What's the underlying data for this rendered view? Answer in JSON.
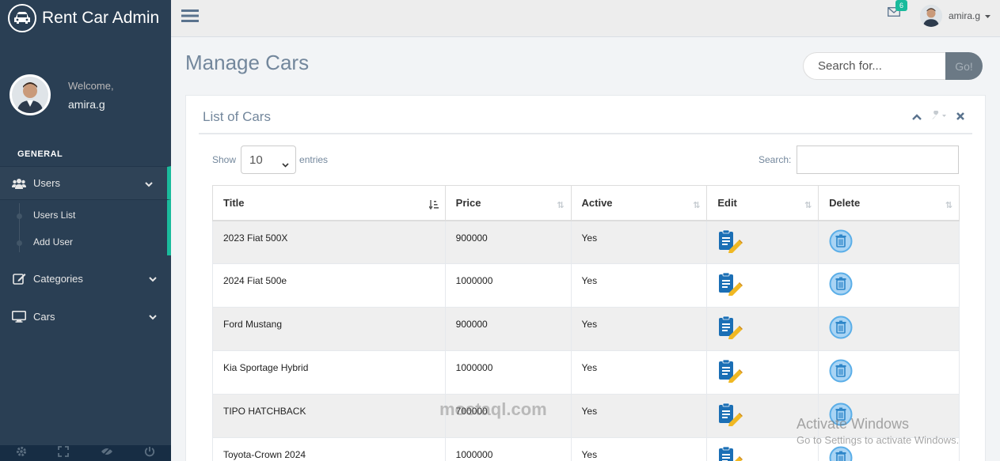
{
  "brand": {
    "title": "Rent Car Admin"
  },
  "profile": {
    "welcome": "Welcome,",
    "username": "amira.g"
  },
  "sidebar": {
    "section": "GENERAL",
    "items": [
      {
        "label": "Users",
        "icon": "users-icon",
        "expanded": true,
        "children": [
          {
            "label": "Users List"
          },
          {
            "label": "Add User"
          }
        ]
      },
      {
        "label": "Categories",
        "icon": "edit-icon"
      },
      {
        "label": "Cars",
        "icon": "monitor-icon"
      }
    ]
  },
  "topnav": {
    "mail_count": "6",
    "username": "amira.g"
  },
  "page": {
    "title": "Manage Cars"
  },
  "search": {
    "placeholder": "Search for...",
    "go": "Go!"
  },
  "panel": {
    "title": "List of Cars"
  },
  "table_controls": {
    "show": "Show",
    "entries_value": "10",
    "entries": "entries",
    "search_label": "Search:"
  },
  "table": {
    "columns": [
      "Title",
      "Price",
      "Active",
      "Edit",
      "Delete"
    ],
    "rows": [
      {
        "title": "2023 Fiat 500X",
        "price": "900000",
        "active": "Yes"
      },
      {
        "title": "2024 Fiat 500e",
        "price": "1000000",
        "active": "Yes"
      },
      {
        "title": "Ford Mustang",
        "price": "900000",
        "active": "Yes"
      },
      {
        "title": "Kia Sportage Hybrid",
        "price": "1000000",
        "active": "Yes"
      },
      {
        "title": "TIPO HATCHBACK",
        "price": "700000",
        "active": "Yes"
      },
      {
        "title": "Toyota-Crown 2024",
        "price": "1000000",
        "active": "Yes"
      }
    ]
  },
  "overlay": {
    "watermark": "mostaql.com",
    "activate_title": "Activate Windows",
    "activate_sub": "Go to Settings to activate Windows."
  },
  "colors": {
    "sidebar": "#2a3f54",
    "accent": "#1abb9c",
    "edit_icon": "#1b6fb5",
    "delete_icon": "#5aaee8"
  }
}
